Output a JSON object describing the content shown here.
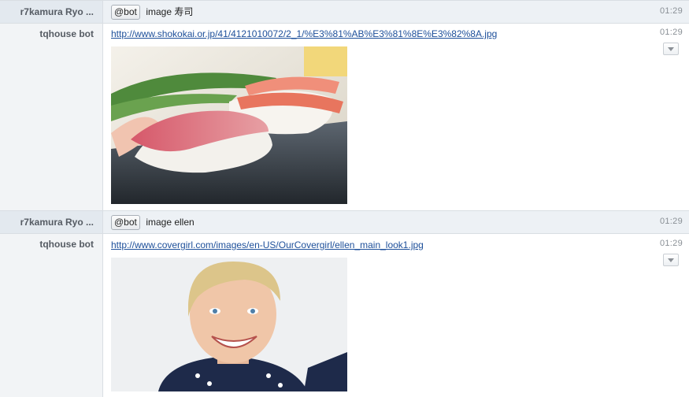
{
  "messages": [
    {
      "sender": "r7kamura Ryo ...",
      "mention": "@bot",
      "text": "image 寿司",
      "time": "01:29"
    },
    {
      "sender": "tqhouse bot",
      "link": "http://www.shokokai.or.jp/41/4121010072/2_1/%E3%81%AB%E3%81%8E%E3%82%8A.jpg",
      "time": "01:29",
      "image_subject": "sushi-photo"
    },
    {
      "sender": "r7kamura Ryo ...",
      "mention": "@bot",
      "text": "image ellen",
      "time": "01:29"
    },
    {
      "sender": "tqhouse bot",
      "link": "http://www.covergirl.com/images/en-US/OurCovergirl/ellen_main_look1.jpg",
      "time": "01:29",
      "image_subject": "portrait-photo"
    }
  ],
  "icons": {
    "message_menu": "chevron-down-icon"
  }
}
